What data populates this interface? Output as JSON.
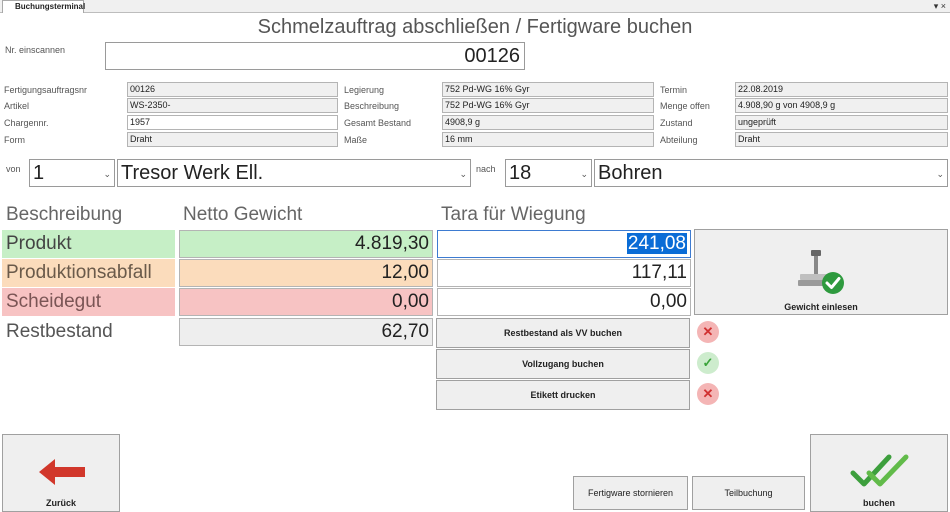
{
  "window": {
    "tab_label": "Buchungsterminal",
    "controls": "▾ ×"
  },
  "title": "Schmelzauftrag abschließen / Fertigware buchen",
  "scan": {
    "label": "Nr. einscannen",
    "value": "00126"
  },
  "info": {
    "fertigungsauftragsnr": {
      "label": "Fertigungsauftragsnr",
      "value": "00126"
    },
    "artikel": {
      "label": "Artikel",
      "value": "WS-2350-"
    },
    "chargennr": {
      "label": "Chargennr.",
      "value": "1957"
    },
    "form": {
      "label": "Form",
      "value": "Draht"
    },
    "legierung": {
      "label": "Legierung",
      "value": "752 Pd-WG 16% Gyr"
    },
    "beschreibung": {
      "label": "Beschreibung",
      "value": "752 Pd-WG 16% Gyr"
    },
    "gesamt_bestand": {
      "label": "Gesamt Bestand",
      "value": "4908,9 g"
    },
    "masse": {
      "label": "Maße",
      "value": "16 mm"
    },
    "termin": {
      "label": "Termin",
      "value": "22.08.2019"
    },
    "menge_offen": {
      "label": "Menge offen",
      "value": "4.908,90 g von 4908,9 g"
    },
    "zustand": {
      "label": "Zustand",
      "value": "ungeprüft"
    },
    "abteilung": {
      "label": "Abteilung",
      "value": "Draht"
    }
  },
  "route": {
    "von_label": "von",
    "von_number": "1",
    "von_name": "Tresor Werk Ell.",
    "nach_label": "nach",
    "nach_number": "18",
    "nach_name": "Bohren"
  },
  "weights": {
    "headers": {
      "beschreibung": "Beschreibung",
      "netto": "Netto Gewicht",
      "tara": "Tara für Wiegung"
    },
    "rows": [
      {
        "label": "Produkt",
        "netto": "4.819,30",
        "tara": "241,08"
      },
      {
        "label": "Produktionsabfall",
        "netto": "12,00",
        "tara": "117,11"
      },
      {
        "label": "Scheidegut",
        "netto": "0,00",
        "tara": "0,00"
      },
      {
        "label": "Restbestand",
        "netto": "62,70"
      }
    ],
    "colors": {
      "produkt": "#c6efc6",
      "abfall": "#fbdcbc",
      "scheidegut": "#f7c3c3",
      "restbestand": "#eeeeee",
      "selection": "#0a6cd6"
    }
  },
  "actions": {
    "gewicht_einlesen": "Gewicht einlesen",
    "restbestand_vv": "Restbestand als VV buchen",
    "vollzugang": "Vollzugang buchen",
    "etikett": "Etikett drucken"
  },
  "footer": {
    "zurueck": "Zurück",
    "stornieren": "Fertigware stornieren",
    "teilbuchung": "Teilbuchung",
    "buchen": "buchen"
  },
  "icons": {
    "scale": "scale-icon",
    "back": "arrow-left-icon",
    "book": "double-check-icon",
    "error": "x-circle-icon",
    "ok": "check-circle-icon"
  }
}
